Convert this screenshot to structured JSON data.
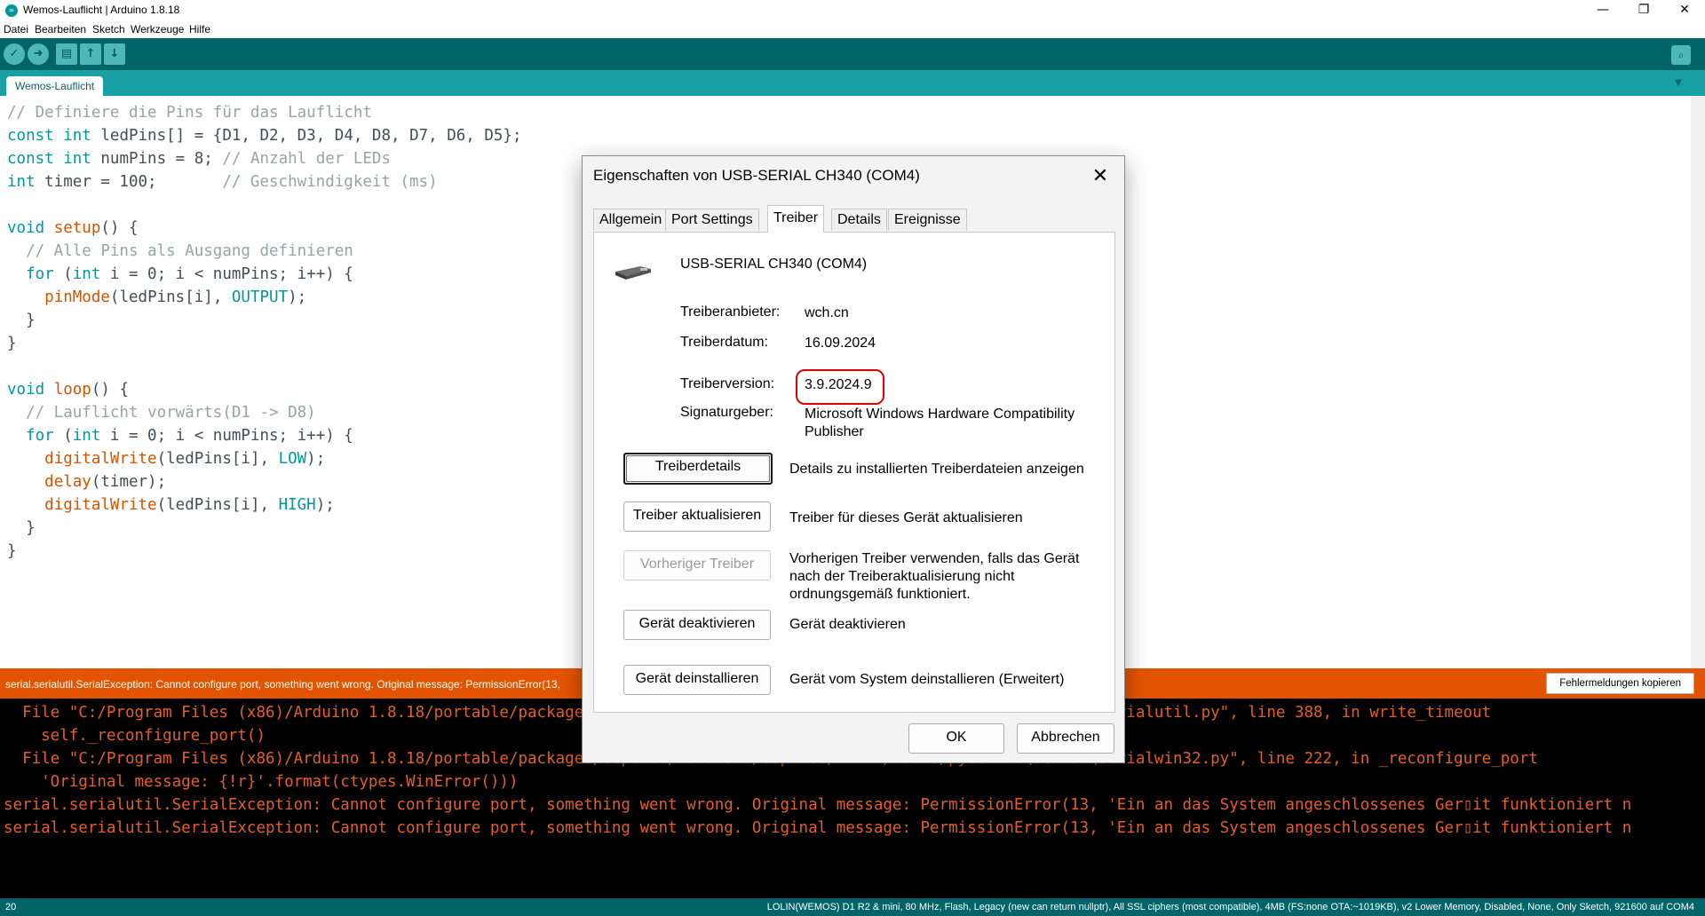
{
  "window": {
    "title": "Wemos-Lauflicht | Arduino 1.8.18",
    "app_icon_text": "∞",
    "minimize": "—",
    "maximize": "❐",
    "close": "✕"
  },
  "menu": [
    "Datei",
    "Bearbeiten",
    "Sketch",
    "Werkzeuge",
    "Hilfe"
  ],
  "toolbar": {
    "verify_icon": "✓",
    "upload_icon": "➜",
    "new_icon": "▤",
    "open_icon": "↑",
    "save_icon": "↓",
    "serial_monitor_icon": "⌕"
  },
  "tabs": {
    "active": "Wemos-Lauflicht",
    "menu_icon": "▼"
  },
  "editor": {
    "lines": [
      "// Definiere die Pins für das Lauflicht",
      "const int ledPins[] = {D1, D2, D3, D4, D8, D7, D6, D5};",
      "const int numPins = 8; // Anzahl der LEDs",
      "int timer = 100;       // Geschwindigkeit (ms)",
      "",
      "void setup() {",
      "  // Alle Pins als Ausgang definieren",
      "  for (int i = 0; i < numPins; i++) {",
      "    pinMode(ledPins[i], OUTPUT);",
      "  }",
      "}",
      "",
      "void loop() {",
      "  // Lauflicht vorwärts(D1 -> D8)",
      "  for (int i = 0; i < numPins; i++) {",
      "    digitalWrite(ledPins[i], LOW);",
      "    delay(timer);",
      "    digitalWrite(ledPins[i], HIGH);",
      "  }",
      "}"
    ]
  },
  "status": {
    "message": "serial.serialutil.SerialException: Cannot configure port, something went wrong. Original message: PermissionError(13,",
    "copy_button": "Fehlermeldungen kopieren"
  },
  "console": {
    "lines": [
      "  File \"C:/Program Files (x86)/Arduino 1.8.18/portable/packages/esp8266/hardware/esp8266/2.7.2/tools/pyserial\\serial\\serialutil.py\", line 388, in write_timeout",
      "    self._reconfigure_port()",
      "  File \"C:/Program Files (x86)/Arduino 1.8.18/portable/packages/esp8266/hardware/esp8266/2.7.2/tools/pyserial\\serial\\serialwin32.py\", line 222, in _reconfigure_port",
      "    'Original message: {!r}'.format(ctypes.WinError()))",
      "serial.serialutil.SerialException: Cannot configure port, something went wrong. Original message: PermissionError(13, 'Ein an das System angeschlossenes Ger▯it funktioniert n",
      "serial.serialutil.SerialException: Cannot configure port, something went wrong. Original message: PermissionError(13, 'Ein an das System angeschlossenes Ger▯it funktioniert n"
    ]
  },
  "bottom": {
    "line_number": "20",
    "board_info": "LOLIN(WEMOS) D1 R2 & mini, 80 MHz, Flash, Legacy (new can return nullptr), All SSL ciphers (most compatible), 4MB (FS:none OTA:~1019KB), v2 Lower Memory, Disabled, None, Only Sketch, 921600 auf COM4"
  },
  "dialog": {
    "title": "Eigenschaften von USB-SERIAL CH340 (COM4)",
    "close_icon": "✕",
    "tabs": [
      "Allgemein",
      "Port Settings",
      "Treiber",
      "Details",
      "Ereignisse"
    ],
    "active_tab": "Treiber",
    "device_name": "USB-SERIAL CH340 (COM4)",
    "fields": [
      {
        "label": "Treiberanbieter:",
        "value": "wch.cn"
      },
      {
        "label": "Treiberdatum:",
        "value": "16.09.2024"
      },
      {
        "label": "Treiberversion:",
        "value": "3.9.2024.9"
      },
      {
        "label": "Signaturgeber:",
        "value": "Microsoft Windows Hardware Compatibility Publisher"
      }
    ],
    "buttons": [
      {
        "label": "Treiberdetails",
        "desc": "Details zu installierten Treiberdateien anzeigen"
      },
      {
        "label": "Treiber aktualisieren",
        "desc": "Treiber für dieses Gerät aktualisieren"
      },
      {
        "label": "Vorheriger Treiber",
        "desc": "Vorherigen Treiber verwenden, falls das Gerät nach der Treiberaktualisierung nicht ordnungsgemäß funktioniert."
      },
      {
        "label": "Gerät deaktivieren",
        "desc": "Gerät deaktivieren"
      },
      {
        "label": "Gerät deinstallieren",
        "desc": "Gerät vom System deinstallieren (Erweitert)"
      }
    ],
    "ok": "OK",
    "cancel": "Abbrechen",
    "highlight_color": "#e00000"
  },
  "colors": {
    "toolbar": "#006468",
    "tabbar": "#17a1a5",
    "status": "#e35400",
    "console_text": "#e35e28"
  }
}
